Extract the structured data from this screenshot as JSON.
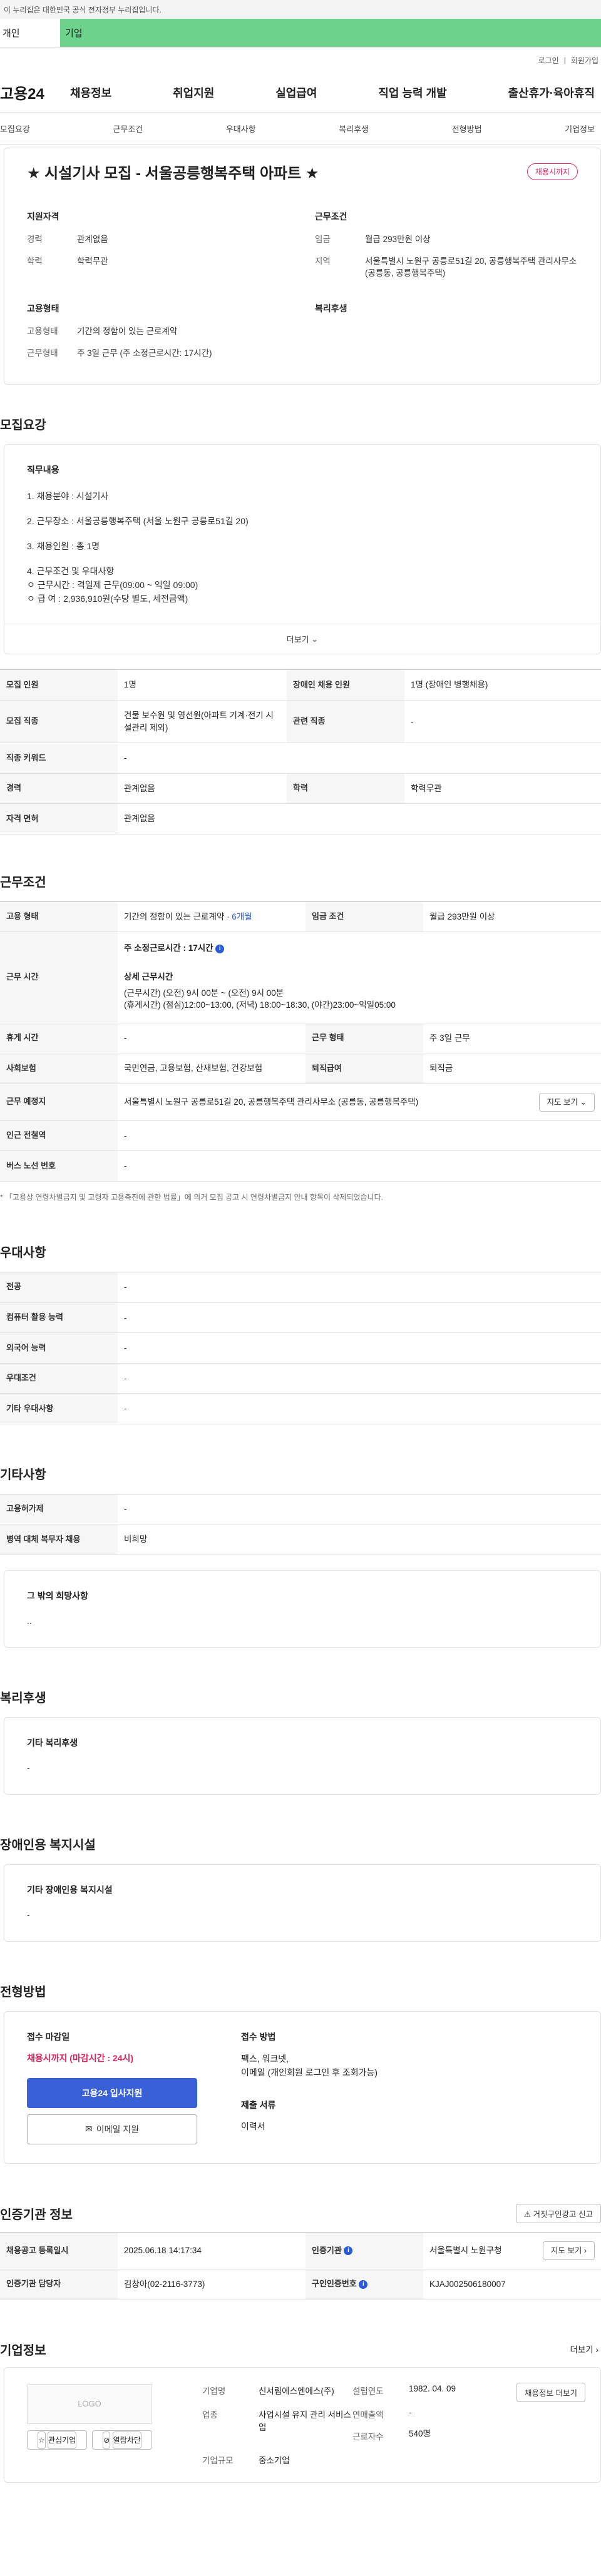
{
  "gov_bar": "이 누리집은 대한민국 공식 전자정부 누리집입니다.",
  "tabs": [
    "개인",
    "기업"
  ],
  "util": [
    "로그인",
    "회원가입"
  ],
  "logo": "고용24",
  "menu": [
    "채용정보",
    "취업지원",
    "실업급여",
    "직업 능력 개발",
    "출산휴가·육아휴직"
  ],
  "anchor_nav": [
    "모집요강",
    "근무조건",
    "우대사항",
    "복리후생",
    "전형방법",
    "기업정보"
  ],
  "title": "★ 시설기사 모집 - 서울공릉행복주택 아파트 ★",
  "status_badge": "채용시까지",
  "summary": {
    "qual_title": "지원자격",
    "career_k": "경력",
    "career_v": "관계없음",
    "edu_k": "학력",
    "edu_v": "학력무관",
    "cond_title": "근무조건",
    "wage_k": "임금",
    "wage_v": "월급 293만원 이상",
    "region_k": "지역",
    "region_v": "서울특별시 노원구 공릉로51길 20, 공릉행복주택 관리사무소 (공릉동, 공릉행복주택)",
    "emp_title": "고용형태",
    "emptype_k": "고용형태",
    "emptype_v": "기간의 정함이 있는 근로계약",
    "worktype_k": "근무형태",
    "worktype_v": "주 3일 근무 (주 소정근로시간: 17시간)",
    "welfare_title": "복리후생"
  },
  "recruit": {
    "section_title": "모집요강",
    "sub": "직무내용",
    "lines": [
      "1. 채용분야 : 시설기사",
      "2. 근무장소 : 서울공릉행복주택 (서울 노원구 공릉로51길 20)",
      "3. 채용인원 : 총 1명",
      "4. 근무조건 및 우대사항",
      "ㅇ 근무시간 : 격일제 근무(09:00 ~ 익일 09:00)",
      "ㅇ 급        여 : 2,936,910원(수당 별도, 세전금액)"
    ],
    "more": "더보기"
  },
  "recruit_table": {
    "r1": [
      "모집 인원",
      "1명",
      "장애인 채용 인원",
      "1명 (장애인 병행채용)"
    ],
    "r2": [
      "모집 직종",
      "건물 보수원 및 영선원(아파트 기계·전기 시설관리 제외)",
      "관련 직종",
      "-"
    ],
    "r3": [
      "직종 키워드",
      "-"
    ],
    "r4": [
      "경력",
      "관계없음",
      "학력",
      "학력무관"
    ],
    "r5": [
      "자격 면허",
      "관계없음"
    ]
  },
  "cond": {
    "section_title": "근무조건",
    "r1": [
      "고용 형태",
      "기간의 정함이 있는 근로계약",
      "· 6개월",
      "임금 조건",
      "월급 293만원 이상"
    ],
    "time_k": "근무 시간",
    "time_total": "주 소정근로시간 : 17시간",
    "time_detail_title": "상세 근무시간",
    "time_detail_1": "(근무시간) (오전) 9시 00분 ~ (오전) 9시 00분",
    "time_detail_2": "(휴게시간) (점심)12:00~13:00, (저녁) 18:00~18:30, (야간)23:00~익일05:00",
    "r3": [
      "휴게 시간",
      "-",
      "근무 형태",
      "주 3일 근무"
    ],
    "r4": [
      "사회보험",
      "국민연금, 고용보험, 산재보험, 건강보험",
      "퇴직급여",
      "퇴직금"
    ],
    "r5": [
      "근무 예정지",
      "서울특별시 노원구 공릉로51길 20, 공릉행복주택 관리사무소 (공릉동, 공릉행복주택)",
      "지도 보기"
    ],
    "r6": [
      "인근 전철역",
      "-"
    ],
    "r7": [
      "버스 노선 번호",
      "-"
    ],
    "note": "* 「고용상 연령차별금지 및 고령자 고용촉진에 관한 법률」에 의거 모집 공고 시 연령차별금지 안내 항목이 삭제되었습니다."
  },
  "pref": {
    "section_title": "우대사항",
    "rows": [
      [
        "전공",
        "-"
      ],
      [
        "컴퓨터 활용 능력",
        "-"
      ],
      [
        "외국어 능력",
        "-"
      ],
      [
        "우대조건",
        "-"
      ],
      [
        "기타 우대사항",
        "-"
      ]
    ]
  },
  "etc": {
    "section_title": "기타사항",
    "rows": [
      [
        "고용허가제",
        "-"
      ],
      [
        "병역 대체 복무자 채용",
        "비희망"
      ]
    ],
    "hope_sub": "그 밖의 희망사항",
    "hope_val": ".."
  },
  "welfare": {
    "section_title": "복리후생",
    "sub": "기타 복리후생",
    "val": "-"
  },
  "disabled": {
    "section_title": "장애인용 복지시설",
    "sub": "기타 장애인용 복지시설",
    "val": "-"
  },
  "process": {
    "section_title": "전형방법",
    "deadline_title": "접수 마감일",
    "deadline_val": "채용시까지 (마감시간 : 24시)",
    "apply_btn": "고용24 입사지원",
    "email_btn": "이메일 지원",
    "method_title": "접수 방법",
    "method_val1": "팩스, 워크넷,",
    "method_val2": "이메일 (개인회원 로그인 후 조회가능)",
    "doc_title": "제출 서류",
    "doc_val": "이력서"
  },
  "cert": {
    "section_title": "인증기관 정보",
    "report_btn": "거짓구인광고 신고",
    "r1": [
      "채용공고 등록일시",
      "2025.06.18 14:17:34",
      "인증기관",
      "서울특별시 노원구청",
      "지도 보기"
    ],
    "r2": [
      "인증기관 담당자",
      "김창아(02-2116-3773)",
      "구인인증번호",
      "KJAJ002506180007"
    ]
  },
  "company": {
    "section_title": "기업정보",
    "more": "더보기",
    "logo": "LOGO",
    "interest_btn": "관심기업",
    "block_btn": "열람차단",
    "name_k": "기업명",
    "name_v": "신서림에스엔에스(주)",
    "found_k": "설립연도",
    "found_v": "1982. 04. 09",
    "biz_k": "업종",
    "biz_v": "사업시설 유지 관리 서비스업",
    "sales_k": "연매출액",
    "sales_v": "-",
    "staff_k": "근로자수",
    "staff_v": "540명",
    "size_k": "기업규모",
    "size_v": "중소기업",
    "jobs_btn": "채용정보 더보기"
  }
}
